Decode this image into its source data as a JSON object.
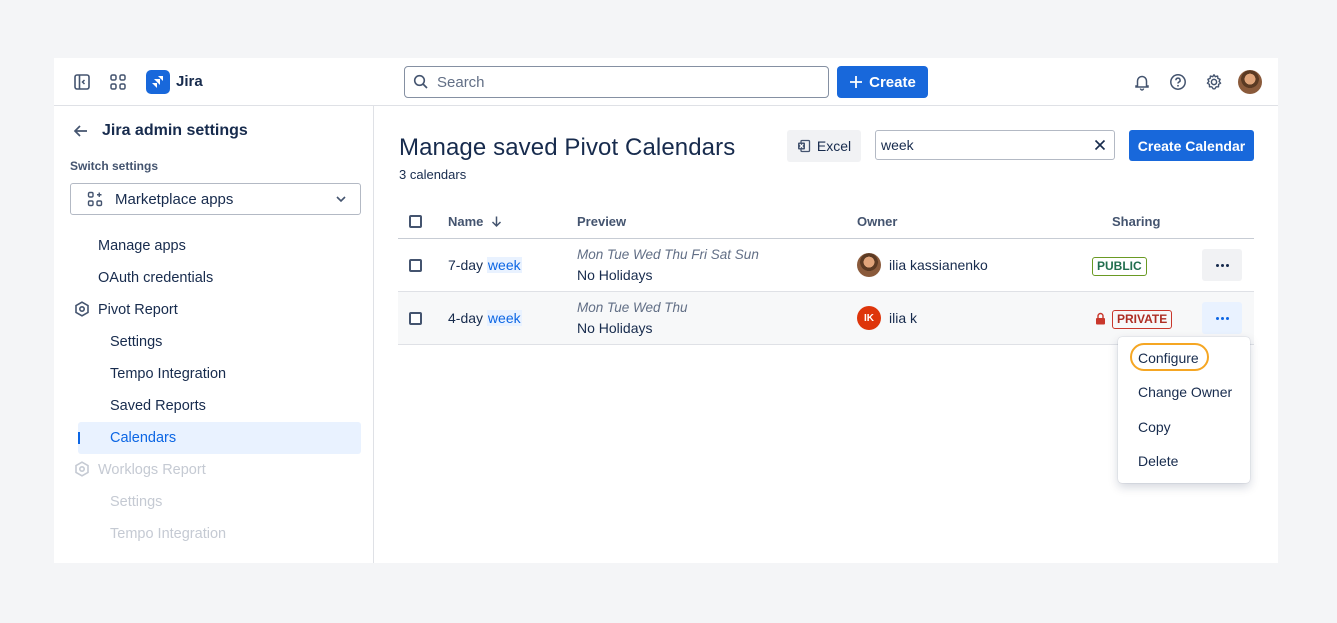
{
  "topbar": {
    "app_name": "Jira",
    "search_placeholder": "Search",
    "create_label": "Create"
  },
  "sidebar": {
    "back_title": "Jira admin settings",
    "switch_label": "Switch settings",
    "switch_value": "Marketplace apps",
    "items": [
      {
        "label": "Manage apps"
      },
      {
        "label": "OAuth credentials"
      },
      {
        "label": "Pivot Report"
      },
      {
        "label": "Settings"
      },
      {
        "label": "Tempo Integration"
      },
      {
        "label": "Saved Reports"
      },
      {
        "label": "Calendars"
      },
      {
        "label": "Worklogs Report"
      },
      {
        "label": "Settings"
      },
      {
        "label": "Tempo Integration"
      }
    ]
  },
  "main": {
    "title": "Manage saved Pivot Calendars",
    "count": "3 calendars",
    "excel_label": "Excel",
    "filter_value": "week",
    "create_calendar_label": "Create Calendar",
    "columns": {
      "name": "Name",
      "preview": "Preview",
      "owner": "Owner",
      "sharing": "Sharing"
    },
    "rows": [
      {
        "name_prefix": "7-day ",
        "name_match": "week",
        "days": "Mon Tue Wed Thu Fri Sat Sun",
        "holidays": "No Holidays",
        "owner": "ilia kassianenko",
        "sharing": "PUBLIC"
      },
      {
        "name_prefix": "4-day ",
        "name_match": "week",
        "days": "Mon Tue Wed Thu",
        "holidays": "No Holidays",
        "owner": "ilia k",
        "owner_initials": "IK",
        "sharing": "PRIVATE"
      }
    ],
    "menu": [
      "Configure",
      "Change Owner",
      "Copy",
      "Delete"
    ]
  },
  "colors": {
    "brand": "#1868db",
    "public": "#216e4e",
    "private": "#ae2e24",
    "focus": "#f5a623"
  }
}
